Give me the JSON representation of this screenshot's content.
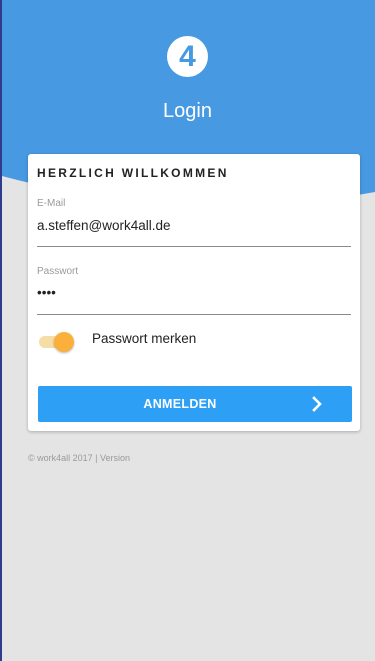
{
  "header": {
    "logo_glyph": "4",
    "title": "Login",
    "bg_color": "#4799e2"
  },
  "card": {
    "title": "HERZLICH WILLKOMMEN",
    "email": {
      "label": "E-Mail",
      "value": "a.steffen@work4all.de"
    },
    "password": {
      "label": "Passwort",
      "value": "••••"
    },
    "remember": {
      "label": "Passwort merken",
      "checked": true,
      "color": "#fbb03b"
    },
    "submit": {
      "label": "ANMELDEN",
      "icon": "chevron-right-icon",
      "color": "#2d9ff5"
    }
  },
  "footer": {
    "text": "© work4all 2017 | Version"
  }
}
